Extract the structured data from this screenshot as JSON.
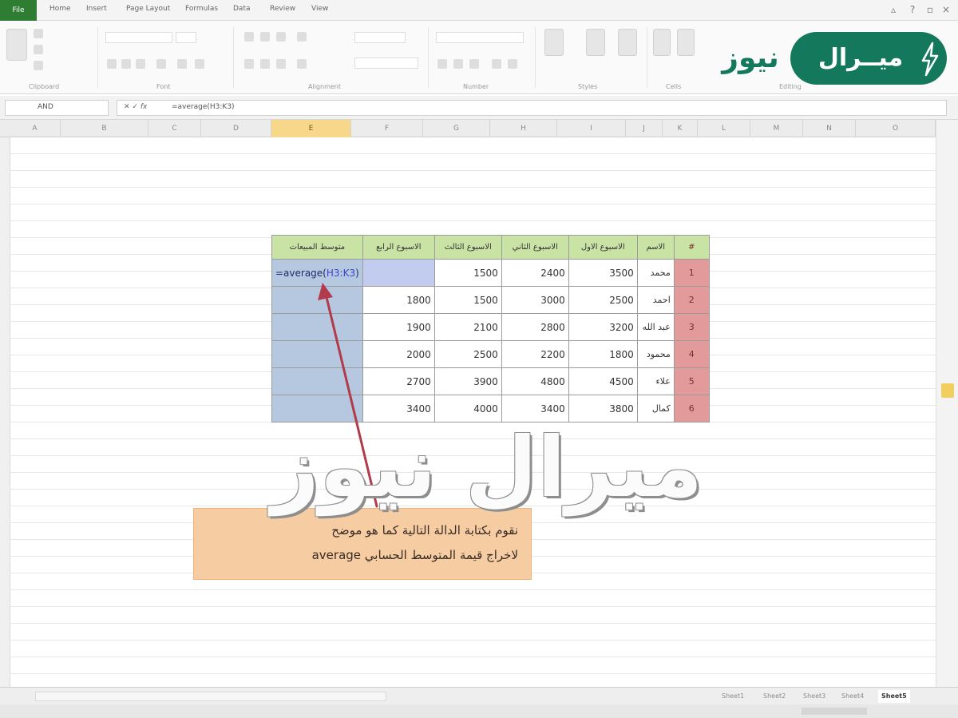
{
  "ribbon": {
    "file_tab": "File",
    "tabs": [
      "Home",
      "Insert",
      "Page Layout",
      "Formulas",
      "Data",
      "Review",
      "View"
    ],
    "groups": [
      "Clipboard",
      "Font",
      "Alignment",
      "Number",
      "Styles",
      "Cells",
      "Editing"
    ]
  },
  "formula_bar": {
    "name_box": "AND",
    "input": "=average(H3:K3)"
  },
  "columns": [
    "A",
    "B",
    "C",
    "D",
    "E",
    "F",
    "G",
    "H",
    "I",
    "J",
    "K",
    "L",
    "M",
    "N",
    "O"
  ],
  "selected_column": "E",
  "table": {
    "headers": [
      "متوسط المبيعات",
      "الاسبوع الرابع",
      "الاسبوع الثالث",
      "الاسبوع الثاني",
      "الاسبوع الاول",
      "الاسم",
      "#"
    ],
    "formula_prefix": "=average(",
    "formula_ref": "H3:K3",
    "formula_suffix": ")",
    "rows": [
      {
        "n": "1",
        "name": "محمد",
        "w1": "3500",
        "w2": "2400",
        "w3": "1500",
        "w4": ""
      },
      {
        "n": "2",
        "name": "احمد",
        "w1": "2500",
        "w2": "3000",
        "w3": "1500",
        "w4": "1800"
      },
      {
        "n": "3",
        "name": "عبد الله",
        "w1": "3200",
        "w2": "2800",
        "w3": "2100",
        "w4": "1900"
      },
      {
        "n": "4",
        "name": "محمود",
        "w1": "1800",
        "w2": "2200",
        "w3": "2500",
        "w4": "2000"
      },
      {
        "n": "5",
        "name": "علاء",
        "w1": "4500",
        "w2": "4800",
        "w3": "3900",
        "w4": "2700"
      },
      {
        "n": "6",
        "name": "كمال",
        "w1": "3800",
        "w2": "3400",
        "w3": "4000",
        "w4": "3400"
      }
    ]
  },
  "note": {
    "line1": "نقوم بكتابة الدالة التالية كما هو موضح",
    "line2": "لاخراج قيمة المتوسط الحسابي average"
  },
  "watermark": "ميرال نيوز",
  "logo": {
    "pill_text": "ميــرال",
    "side_text": "نيوز"
  },
  "sheets": [
    "Sheet1",
    "Sheet2",
    "Sheet3",
    "Sheet4",
    "Sheet5"
  ],
  "active_sheet": "Sheet5",
  "colors": {
    "header_green": "#c9e3a5",
    "avg_blue": "#b5c8e0",
    "rownum_red": "#e29a9a",
    "note_orange": "#f6cca3",
    "logo_green": "#14785c",
    "arrow": "#b23a4a"
  }
}
